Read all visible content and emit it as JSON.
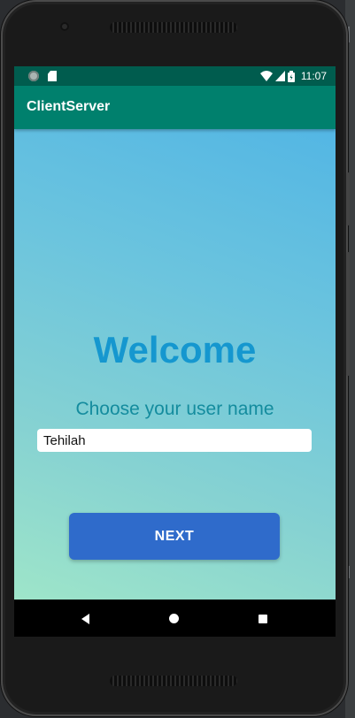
{
  "status_bar": {
    "time": "11:07",
    "left_icons": [
      "sync-circle-icon",
      "sd-card-icon"
    ],
    "right_icons": [
      "wifi-icon",
      "signal-icon",
      "battery-icon"
    ]
  },
  "app_bar": {
    "title": "ClientServer"
  },
  "main": {
    "welcome": "Welcome",
    "subtitle": "Choose your user name",
    "username_value": "Tehilah",
    "next_label": "NEXT"
  },
  "nav_bar": {
    "icons": [
      "back-icon",
      "home-icon",
      "recents-icon"
    ]
  },
  "colors": {
    "status_bar": "#005c4e",
    "app_bar": "#00806d",
    "welcome_text": "#1597cf",
    "subtitle_text": "#148c9e",
    "button": "#2f6bcb",
    "gradient_top": "#53b6e4",
    "gradient_bottom": "#9ee5c9"
  }
}
